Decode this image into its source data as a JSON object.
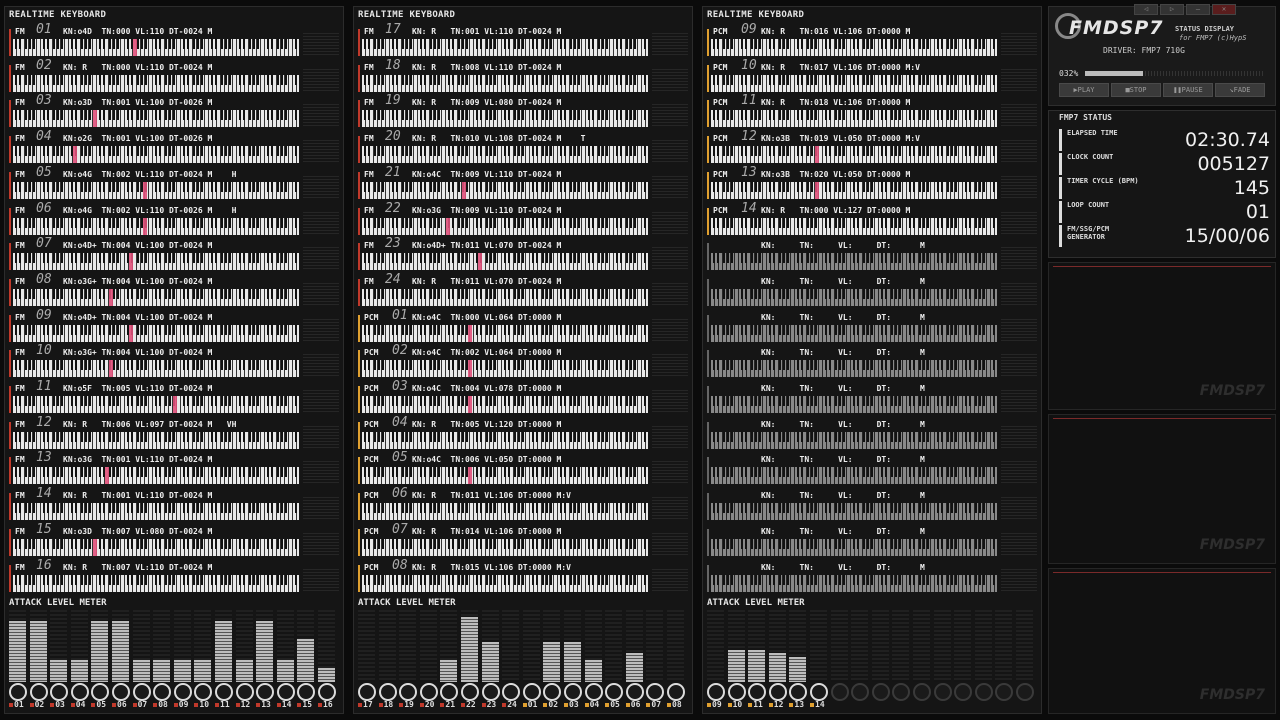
{
  "panels": [
    {
      "title": "REALTIME KEYBOARD",
      "meter_title": "ATTACK LEVEL METER",
      "channels": [
        {
          "kind": "FM",
          "num": "01",
          "info": "KN:o4D  TN:000 VL:110 DT-0024 M"
        },
        {
          "kind": "FM",
          "num": "02",
          "info": "KN: R   TN:000 VL:110 DT-0024 M"
        },
        {
          "kind": "FM",
          "num": "03",
          "info": "KN:o3D  TN:001 VL:100 DT-0026 M"
        },
        {
          "kind": "FM",
          "num": "04",
          "info": "KN:o2G  TN:001 VL:100 DT-0026 M"
        },
        {
          "kind": "FM",
          "num": "05",
          "info": "KN:o4G  TN:002 VL:110 DT-0024 M    H"
        },
        {
          "kind": "FM",
          "num": "06",
          "info": "KN:o4G  TN:002 VL:110 DT-0026 M    H"
        },
        {
          "kind": "FM",
          "num": "07",
          "info": "KN:o4D+ TN:004 VL:100 DT-0024 M"
        },
        {
          "kind": "FM",
          "num": "08",
          "info": "KN:o3G+ TN:004 VL:100 DT-0024 M"
        },
        {
          "kind": "FM",
          "num": "09",
          "info": "KN:o4D+ TN:004 VL:100 DT-0024 M"
        },
        {
          "kind": "FM",
          "num": "10",
          "info": "KN:o3G+ TN:004 VL:100 DT-0024 M"
        },
        {
          "kind": "FM",
          "num": "11",
          "info": "KN:o5F  TN:005 VL:110 DT-0024 M"
        },
        {
          "kind": "FM",
          "num": "12",
          "info": "KN: R   TN:006 VL:097 DT-0024 M   VH"
        },
        {
          "kind": "FM",
          "num": "13",
          "info": "KN:o3G  TN:001 VL:110 DT-0024 M"
        },
        {
          "kind": "FM",
          "num": "14",
          "info": "KN: R   TN:001 VL:110 DT-0024 M"
        },
        {
          "kind": "FM",
          "num": "15",
          "info": "KN:o3D  TN:007 VL:080 DT-0024 M"
        },
        {
          "kind": "FM",
          "num": "16",
          "info": "KN: R   TN:007 VL:110 DT-0024 M"
        }
      ],
      "meter_levels": [
        0.85,
        0.85,
        0.3,
        0.3,
        0.85,
        0.85,
        0.3,
        0.3,
        0.3,
        0.3,
        0.85,
        0.3,
        0.85,
        0.3,
        0.6,
        0.2
      ],
      "knob_labels": [
        "01",
        "02",
        "03",
        "04",
        "05",
        "06",
        "07",
        "08",
        "09",
        "10",
        "11",
        "12",
        "13",
        "14",
        "15",
        "16"
      ]
    },
    {
      "title": "REALTIME KEYBOARD",
      "meter_title": "ATTACK LEVEL METER",
      "channels": [
        {
          "kind": "FM",
          "num": "17",
          "info": "KN: R   TN:001 VL:110 DT-0024 M"
        },
        {
          "kind": "FM",
          "num": "18",
          "info": "KN: R   TN:008 VL:110 DT-0024 M"
        },
        {
          "kind": "FM",
          "num": "19",
          "info": "KN: R   TN:009 VL:080 DT-0024 M"
        },
        {
          "kind": "FM",
          "num": "20",
          "info": "KN: R   TN:010 VL:108 DT-0024 M    T"
        },
        {
          "kind": "FM",
          "num": "21",
          "info": "KN:o4C  TN:009 VL:110 DT-0024 M"
        },
        {
          "kind": "FM",
          "num": "22",
          "info": "KN:o3G  TN:009 VL:110 DT-0024 M"
        },
        {
          "kind": "FM",
          "num": "23",
          "info": "KN:o4D+ TN:011 VL:070 DT-0024 M"
        },
        {
          "kind": "FM",
          "num": "24",
          "info": "KN: R   TN:011 VL:070 DT-0024 M"
        },
        {
          "kind": "PCM",
          "num": "01",
          "info": "KN:o4C  TN:000 VL:064 DT:0000 M"
        },
        {
          "kind": "PCM",
          "num": "02",
          "info": "KN:o4C  TN:002 VL:064 DT:0000 M"
        },
        {
          "kind": "PCM",
          "num": "03",
          "info": "KN:o4C  TN:004 VL:078 DT:0000 M"
        },
        {
          "kind": "PCM",
          "num": "04",
          "info": "KN: R   TN:005 VL:120 DT:0000 M"
        },
        {
          "kind": "PCM",
          "num": "05",
          "info": "KN:o4C  TN:006 VL:050 DT:0000 M"
        },
        {
          "kind": "PCM",
          "num": "06",
          "info": "KN: R   TN:011 VL:106 DT:0000 M:V"
        },
        {
          "kind": "PCM",
          "num": "07",
          "info": "KN: R   TN:014 VL:106 DT:0000 M"
        },
        {
          "kind": "PCM",
          "num": "08",
          "info": "KN: R   TN:015 VL:106 DT:0000 M:V"
        }
      ],
      "meter_levels": [
        0,
        0,
        0,
        0,
        0.3,
        0.9,
        0.55,
        0,
        0,
        0.55,
        0.55,
        0.3,
        0,
        0.4,
        0,
        0
      ],
      "knob_labels": [
        "17",
        "18",
        "19",
        "20",
        "21",
        "22",
        "23",
        "24",
        "01",
        "02",
        "03",
        "04",
        "05",
        "06",
        "07",
        "08"
      ]
    },
    {
      "title": "REALTIME KEYBOARD",
      "meter_title": "ATTACK LEVEL METER",
      "channels": [
        {
          "kind": "PCM",
          "num": "09",
          "info": "KN: R   TN:016 VL:106 DT:0000 M"
        },
        {
          "kind": "PCM",
          "num": "10",
          "info": "KN: R   TN:017 VL:106 DT:0000 M:V"
        },
        {
          "kind": "PCM",
          "num": "11",
          "info": "KN: R   TN:018 VL:106 DT:0000 M"
        },
        {
          "kind": "PCM",
          "num": "12",
          "info": "KN:o3B  TN:019 VL:050 DT:0000 M:V"
        },
        {
          "kind": "PCM",
          "num": "13",
          "info": "KN:o3B  TN:020 VL:050 DT:0000 M"
        },
        {
          "kind": "PCM",
          "num": "14",
          "info": "KN: R   TN:000 VL:127 DT:0000 M"
        },
        {
          "kind": "",
          "num": "",
          "info": "KN:     TN:     VL:     DT:      M"
        },
        {
          "kind": "",
          "num": "",
          "info": "KN:     TN:     VL:     DT:      M"
        },
        {
          "kind": "",
          "num": "",
          "info": "KN:     TN:     VL:     DT:      M"
        },
        {
          "kind": "",
          "num": "",
          "info": "KN:     TN:     VL:     DT:      M"
        },
        {
          "kind": "",
          "num": "",
          "info": "KN:     TN:     VL:     DT:      M"
        },
        {
          "kind": "",
          "num": "",
          "info": "KN:     TN:     VL:     DT:      M"
        },
        {
          "kind": "",
          "num": "",
          "info": "KN:     TN:     VL:     DT:      M"
        },
        {
          "kind": "",
          "num": "",
          "info": "KN:     TN:     VL:     DT:      M"
        },
        {
          "kind": "",
          "num": "",
          "info": "KN:     TN:     VL:     DT:      M"
        },
        {
          "kind": "",
          "num": "",
          "info": "KN:     TN:     VL:     DT:      M"
        }
      ],
      "meter_levels": [
        0,
        0.45,
        0.45,
        0.4,
        0.35,
        0,
        0,
        0,
        0,
        0,
        0,
        0,
        0,
        0,
        0,
        0
      ],
      "knob_labels": [
        "09",
        "10",
        "11",
        "12",
        "13",
        "14",
        "",
        "",
        "",
        "",
        "",
        "",
        "",
        "",
        "",
        ""
      ]
    }
  ],
  "status": {
    "logo": "FMDSP7",
    "subtitle1": "STATUS DISPLAY",
    "subtitle2": "for FMP7 (c)HypS",
    "driver": "DRIVER: FMP7  710G",
    "progress_label": "032%",
    "progress": 0.32,
    "buttons": [
      "▶PLAY",
      "■STOP",
      "❚❚PAUSE",
      "↘FADE"
    ]
  },
  "fmp_status": {
    "title": "FMP7 STATUS",
    "rows": [
      {
        "label": "ELAPSED TIME",
        "value": "02:30.74"
      },
      {
        "label": "CLOCK COUNT",
        "value": "005127"
      },
      {
        "label": "TIMER CYCLE (BPM)",
        "value": "145"
      },
      {
        "label": "LOOP COUNT",
        "value": "01"
      },
      {
        "label": "FM/SSG/PCM GENERATOR",
        "value": "15/00/06"
      }
    ]
  },
  "watermark": "FMDSP7",
  "window_buttons": [
    "",
    "◁",
    "▷",
    "—",
    "✕"
  ]
}
